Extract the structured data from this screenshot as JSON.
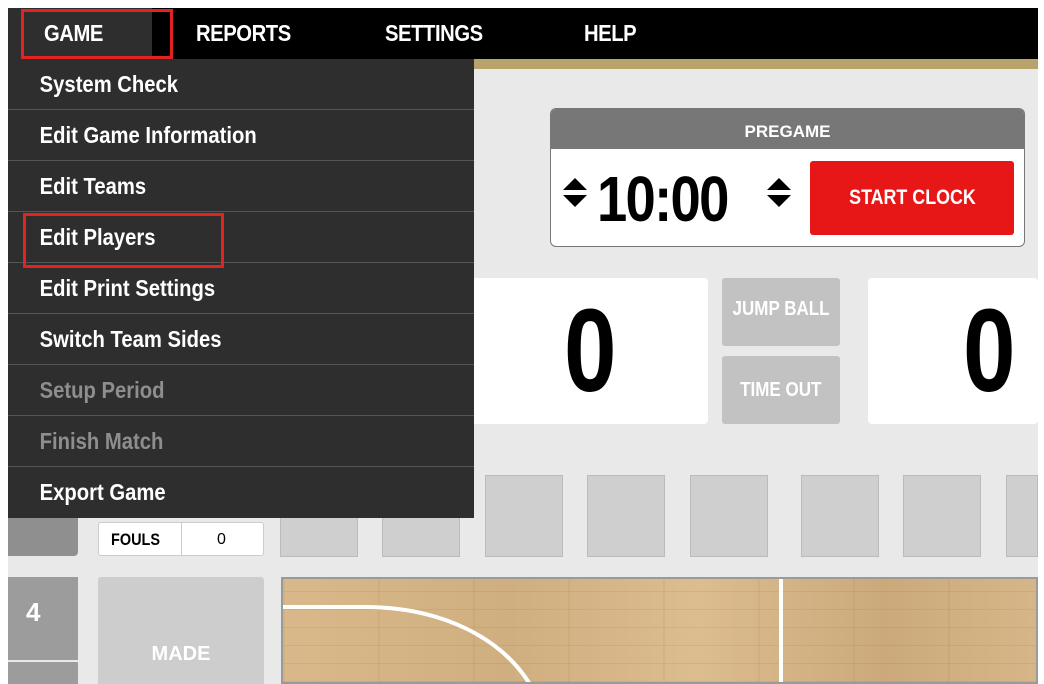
{
  "nav": {
    "items": [
      {
        "label": "GAME"
      },
      {
        "label": "REPORTS"
      },
      {
        "label": "SETTINGS"
      },
      {
        "label": "HELP"
      }
    ]
  },
  "game_menu": {
    "items": [
      {
        "label": "System Check",
        "enabled": true
      },
      {
        "label": "Edit Game Information",
        "enabled": true
      },
      {
        "label": "Edit Teams",
        "enabled": true
      },
      {
        "label": "Edit Players",
        "enabled": true
      },
      {
        "label": "Edit Print Settings",
        "enabled": true
      },
      {
        "label": "Switch Team Sides",
        "enabled": true
      },
      {
        "label": "Setup Period",
        "enabled": false
      },
      {
        "label": "Finish Match",
        "enabled": false
      },
      {
        "label": "Export Game",
        "enabled": true
      }
    ]
  },
  "clock": {
    "status": "PREGAME",
    "time": "10:00",
    "start_label": "START CLOCK"
  },
  "scores": {
    "home": "0",
    "away": "0"
  },
  "center_buttons": {
    "jump_ball": "JUMP BALL",
    "time_out": "TIME OUT"
  },
  "fouls": {
    "label": "FOULS",
    "value": "0"
  },
  "player": {
    "number": "4",
    "made_label": "MADE"
  },
  "colors": {
    "nav_bg": "#000000",
    "menu_bg": "#2e2e2e",
    "accent_gold": "#b8a36b",
    "start_red": "#e81717",
    "highlight_red": "#e32222"
  }
}
